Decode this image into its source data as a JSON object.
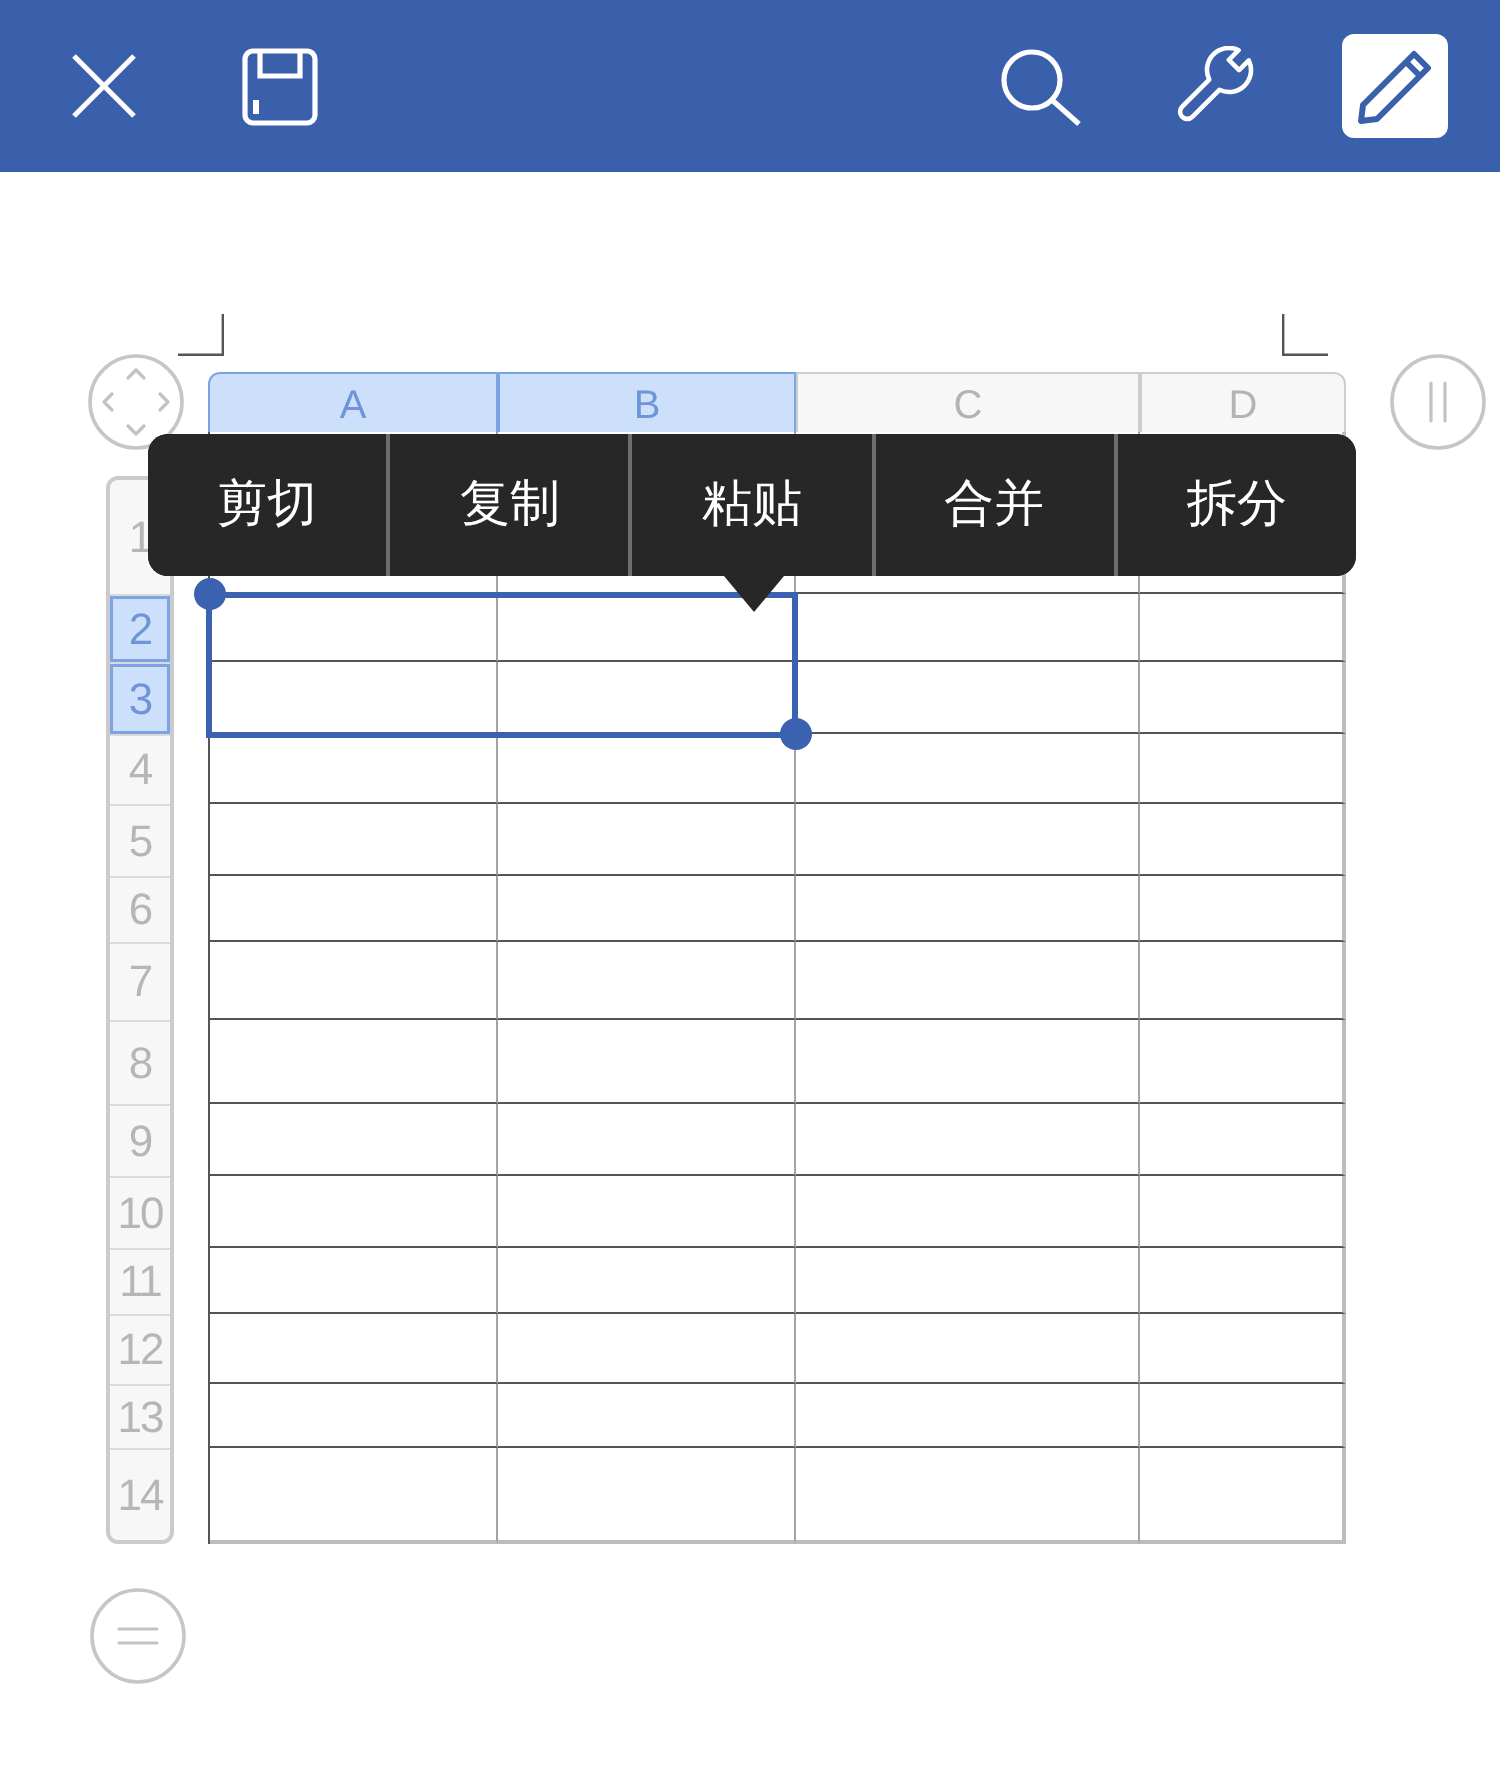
{
  "toolbar": {
    "left": [
      {
        "kind": "close",
        "on": false
      },
      {
        "kind": "save",
        "on": false
      }
    ],
    "right": [
      {
        "kind": "search",
        "on": false
      },
      {
        "kind": "wrench",
        "on": false
      },
      {
        "kind": "pencil",
        "on": true
      }
    ]
  },
  "sheet": {
    "columns": [
      {
        "label": "A",
        "selected": true
      },
      {
        "label": "B",
        "selected": true
      },
      {
        "label": "C",
        "selected": false
      },
      {
        "label": "D",
        "selected": false
      }
    ],
    "rows": [
      {
        "label": "1",
        "selected": false
      },
      {
        "label": "2",
        "selected": true
      },
      {
        "label": "3",
        "selected": true
      },
      {
        "label": "4",
        "selected": false
      },
      {
        "label": "5",
        "selected": false
      },
      {
        "label": "6",
        "selected": false
      },
      {
        "label": "7",
        "selected": false
      },
      {
        "label": "8",
        "selected": false
      },
      {
        "label": "9",
        "selected": false
      },
      {
        "label": "10",
        "selected": false
      },
      {
        "label": "11",
        "selected": false
      },
      {
        "label": "12",
        "selected": false
      },
      {
        "label": "13",
        "selected": false
      },
      {
        "label": "14",
        "selected": false
      }
    ]
  },
  "context_menu": {
    "items": [
      {
        "label": "剪切"
      },
      {
        "label": "复制"
      },
      {
        "label": "粘贴"
      },
      {
        "label": "合并"
      },
      {
        "label": "拆分"
      }
    ]
  }
}
